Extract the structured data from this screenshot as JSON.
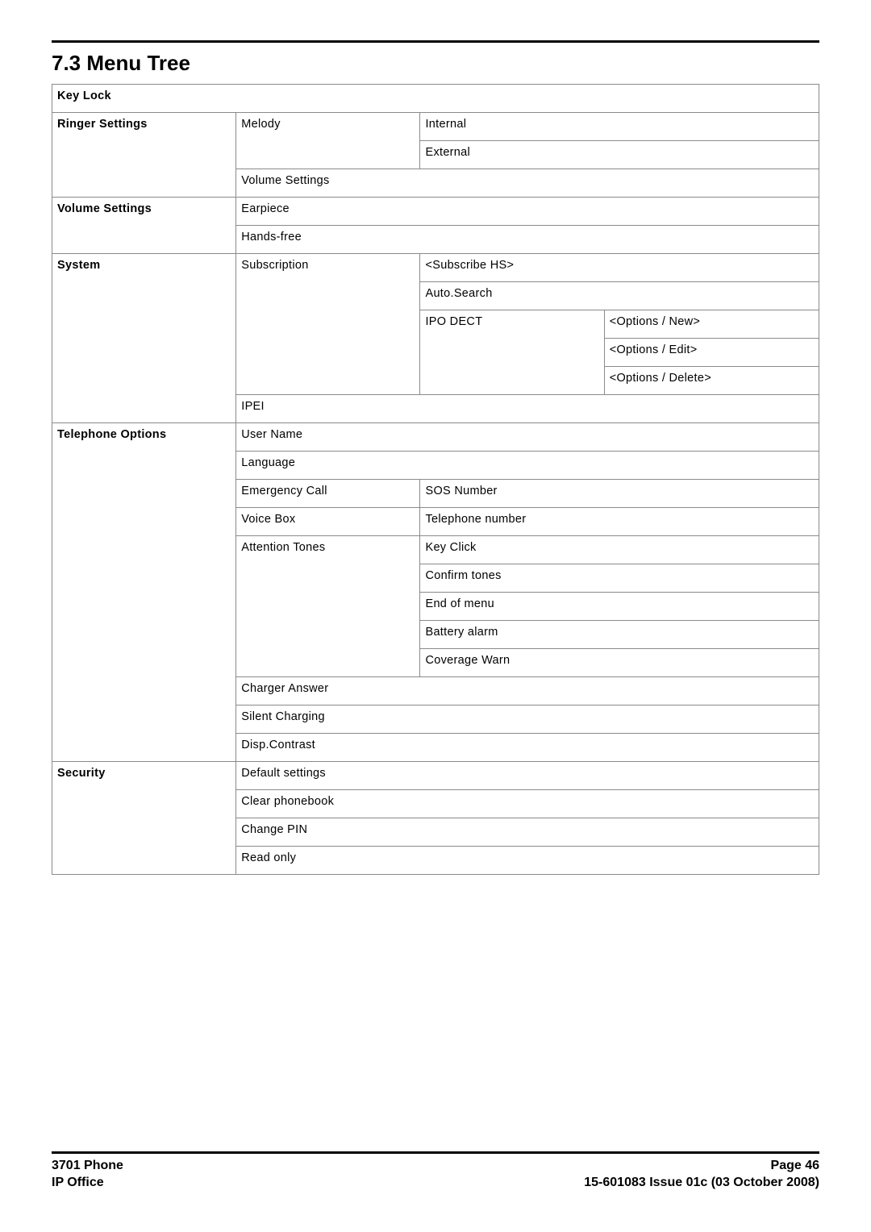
{
  "section_title": "7.3 Menu Tree",
  "menu": {
    "key_lock": "Key Lock",
    "ringer_settings": {
      "label": "Ringer Settings",
      "melody": {
        "label": "Melody",
        "internal": "Internal",
        "external": "External"
      },
      "volume_settings": "Volume Settings"
    },
    "volume_settings": {
      "label": "Volume Settings",
      "earpiece": "Earpiece",
      "hands_free": "Hands-free"
    },
    "system": {
      "label": "System",
      "subscription": {
        "label": "Subscription",
        "subscribe_hs": "<Subscribe HS>",
        "auto_search": "Auto.Search",
        "ipo_dect": {
          "label": "IPO DECT",
          "options_new": "<Options / New>",
          "options_edit": "<Options / Edit>",
          "options_delete": "<Options / Delete>"
        }
      },
      "ipei": "IPEI"
    },
    "telephone_options": {
      "label": "Telephone Options",
      "user_name": "User Name",
      "language": "Language",
      "emergency_call": {
        "label": "Emergency Call",
        "sos_number": "SOS Number"
      },
      "voice_box": {
        "label": "Voice Box",
        "telephone_number": "Telephone number"
      },
      "attention_tones": {
        "label": "Attention Tones",
        "key_click": "Key Click",
        "confirm_tones": "Confirm tones",
        "end_of_menu": "End of menu",
        "battery_alarm": "Battery alarm",
        "coverage_warn": "Coverage Warn"
      },
      "charger_answer": "Charger Answer",
      "silent_charging": "Silent Charging",
      "disp_contrast": "Disp.Contrast"
    },
    "security": {
      "label": "Security",
      "default_settings": "Default settings",
      "clear_phonebook": "Clear phonebook",
      "change_pin": "Change PIN",
      "read_only": "Read only"
    }
  },
  "footer": {
    "left1": "3701 Phone",
    "left2": "IP Office",
    "right1": "Page 46",
    "right2": "15-601083 Issue 01c (03 October 2008)"
  }
}
